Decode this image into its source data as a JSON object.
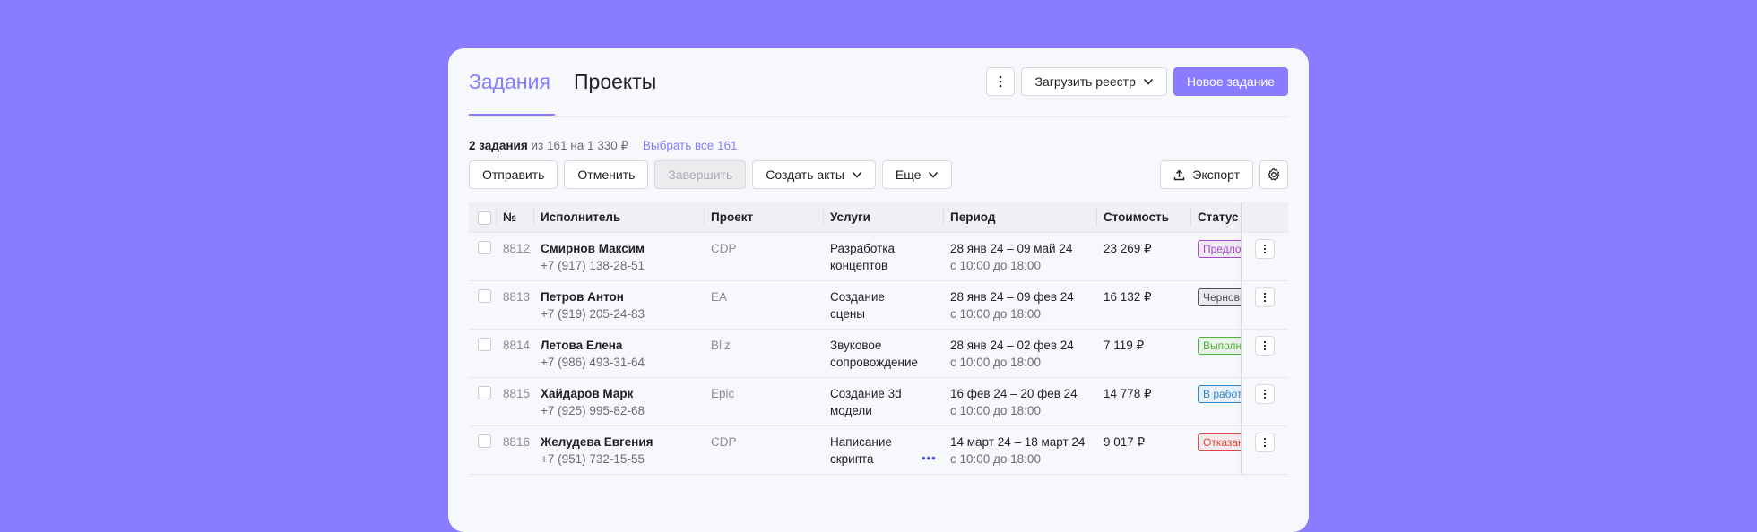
{
  "tabs": {
    "active": "Задания",
    "other": "Проекты"
  },
  "header_actions": {
    "more_icon": "more-vertical-icon",
    "upload_label": "Загрузить реестр",
    "new_task_label": "Новое задание"
  },
  "summary": {
    "selected": "2 задания",
    "of": "из 161",
    "amount": "на 1 330 ₽",
    "select_all": "Выбрать все 161"
  },
  "toolbar": {
    "send": "Отправить",
    "cancel": "Отменить",
    "complete": "Завершить",
    "create_acts": "Создать акты",
    "more": "Еще",
    "export": "Экспорт"
  },
  "columns": {
    "num": "№",
    "executor": "Исполнитель",
    "project": "Проект",
    "services": "Услуги",
    "period": "Период",
    "cost": "Стоимость",
    "status": "Статус"
  },
  "rows": [
    {
      "num": "8812",
      "name": "Смирнов Максим",
      "phone": "+7 (917) 138-28-51",
      "project": "CDP",
      "service1": "Разработка",
      "service2": "концептов",
      "period": "28 янв 24 – 09 май 24",
      "time": "с 10:00 до 18:00",
      "cost": "23 269 ₽",
      "status": "Предложено",
      "status_color": "#a54ac7"
    },
    {
      "num": "8813",
      "name": "Петров Антон",
      "phone": "+7 (919) 205-24-83",
      "project": "EA",
      "service1": "Создание сцены",
      "service2": "",
      "period": "28 янв 24 – 09 фев 24",
      "time": "с 10:00 до 18:00",
      "cost": "16 132 ₽",
      "status": "Черновик",
      "status_color": "#4d4e57"
    },
    {
      "num": "8814",
      "name": "Летова Елена",
      "phone": "+7 (986) 493-31-64",
      "project": "Bliz",
      "service1": "Звуковое",
      "service2": "сопровождение",
      "period": "28 янв 24 – 02 фев 24",
      "time": "с 10:00 до 18:00",
      "cost": "7 119 ₽",
      "status": "Выполнено",
      "status_color": "#4fb334"
    },
    {
      "num": "8815",
      "name": "Хайдаров Марк",
      "phone": "+7 (925) 995-82-68",
      "project": "Epic",
      "service1": "Создание 3d",
      "service2": "модели",
      "period": "16 фев 24 – 20 фев 24",
      "time": "с 10:00 до 18:00",
      "cost": "14 778 ₽",
      "status": "В работе",
      "status_color": "#2f86d4"
    },
    {
      "num": "8816",
      "name": "Желудева Евгения",
      "phone": "+7 (951) 732-15-55",
      "project": "CDP",
      "service1": "Написание",
      "service2": "скрипта",
      "period": "14 март 24 – 18 март 24",
      "time": "с 10:00 до 18:00",
      "cost": "9 017 ₽",
      "status": "Отказано",
      "status_color": "#e0483f"
    }
  ],
  "colors": {
    "accent": "#8a7cff",
    "background": "#8a7cff",
    "card": "#f7f8fb"
  }
}
